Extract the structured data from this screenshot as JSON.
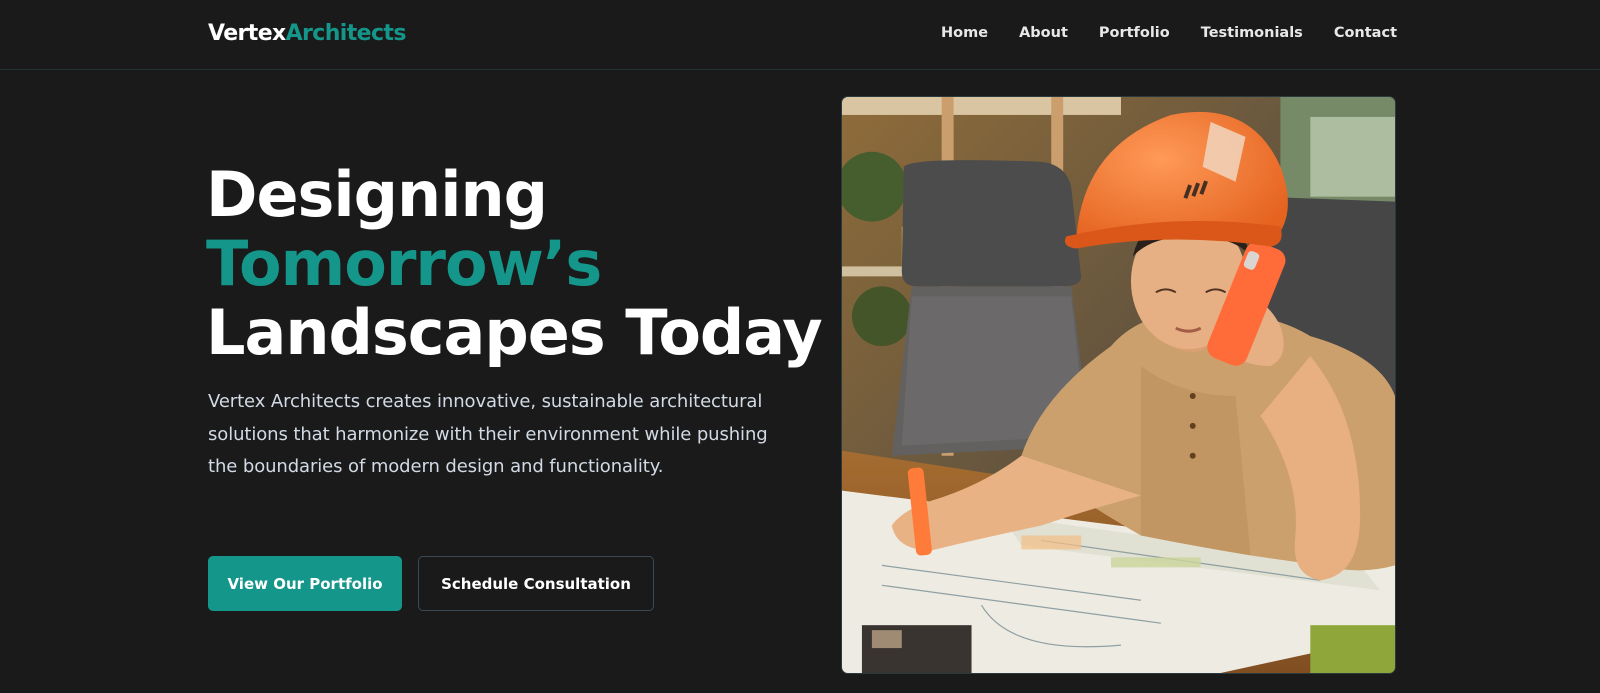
{
  "brand": {
    "name_part1": "Vertex",
    "name_part2": "Architects",
    "accent_color": "#15968a"
  },
  "nav": {
    "items": [
      {
        "label": "Home"
      },
      {
        "label": "About"
      },
      {
        "label": "Portfolio"
      },
      {
        "label": "Testimonials"
      },
      {
        "label": "Contact"
      }
    ]
  },
  "hero": {
    "title_line1": "Designing",
    "title_line2": "Tomorrow’s",
    "title_line3": "Landscapes Today",
    "description": "Vertex Architects creates innovative, sustainable architectural solutions that harmonize with their environment while pushing the boundaries of modern design and functionality.",
    "primary_button": "View Our Portfolio",
    "secondary_button": "Schedule Consultation"
  },
  "image": {
    "icon": "architect-photo-icon"
  }
}
